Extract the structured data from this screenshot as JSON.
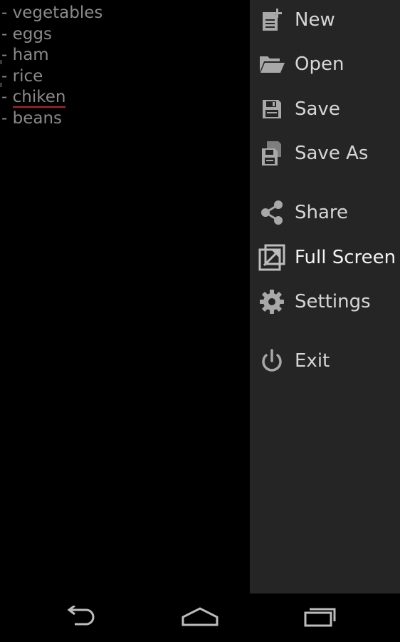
{
  "editor": {
    "lines": [
      {
        "prefix": "- ",
        "text": "vegetables"
      },
      {
        "prefix": "- ",
        "text": "eggs"
      },
      {
        "prefix": "- ",
        "text": "ham"
      },
      {
        "prefix": "- ",
        "text": "rice"
      },
      {
        "prefix": "- ",
        "text": "chiken",
        "misspelled": true
      },
      {
        "prefix": "- ",
        "text": "beans"
      }
    ]
  },
  "menu": {
    "items": [
      {
        "label": "New",
        "icon": "new-document-icon"
      },
      {
        "label": "Open",
        "icon": "folder-open-icon"
      },
      {
        "label": "Save",
        "icon": "floppy-disk-icon"
      },
      {
        "label": "Save As",
        "icon": "save-as-icon"
      },
      {
        "label": "Share",
        "icon": "share-icon"
      },
      {
        "label": "Full Screen",
        "icon": "full-screen-icon"
      },
      {
        "label": "Settings",
        "icon": "gear-icon"
      },
      {
        "label": "Exit",
        "icon": "power-icon"
      }
    ]
  },
  "navbar": {
    "buttons": [
      {
        "icon": "back-icon"
      },
      {
        "icon": "home-icon"
      },
      {
        "icon": "recent-apps-icon"
      }
    ]
  },
  "colors": {
    "background": "#000000",
    "menu_background": "#252525",
    "text": "#8a8a8a",
    "menu_text": "#d6d6d6",
    "spellcheck_underline": "#b0262a"
  }
}
